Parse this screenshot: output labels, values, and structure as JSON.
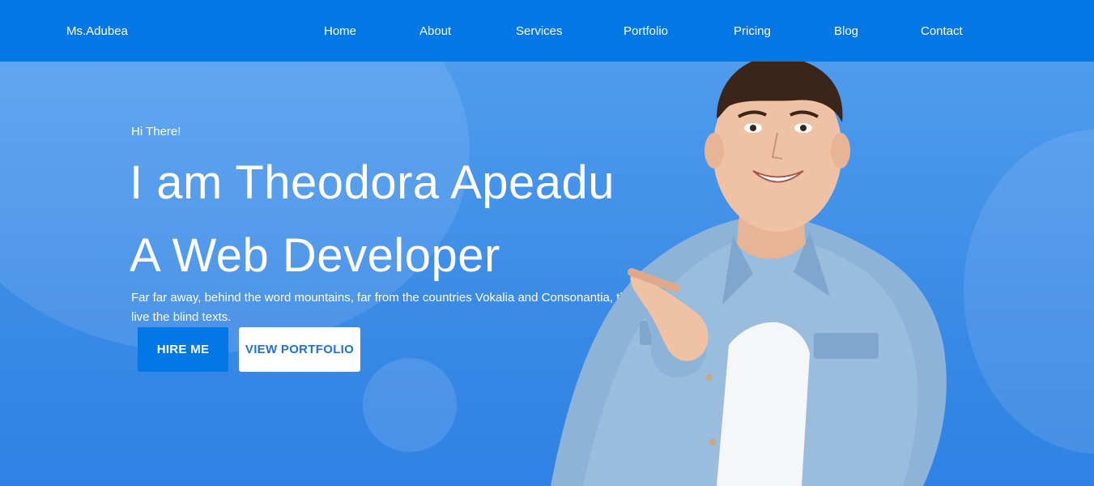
{
  "nav": {
    "brand": "Ms.Adubea",
    "links": [
      "Home",
      "About",
      "Services",
      "Portfolio",
      "Pricing",
      "Blog",
      "Contact"
    ]
  },
  "hero": {
    "greeting": "Hi There!",
    "headline_line1": "I am Theodora Apeadu",
    "headline_line2": "A Web Developer",
    "description": "Far far away, behind the word mountains, far from the countries Vokalia and Consonantia, there live the blind texts.",
    "hire_button": "HIRE ME",
    "portfolio_button": "VIEW PORTFOLIO"
  },
  "colors": {
    "navbar": "#0477e6",
    "hero_background": "#3b8eea",
    "primary_button": "#0477e6",
    "secondary_button_text": "#1f72d4"
  },
  "icons": {
    "hero_image": "smiling-man-pointing-illustration"
  }
}
